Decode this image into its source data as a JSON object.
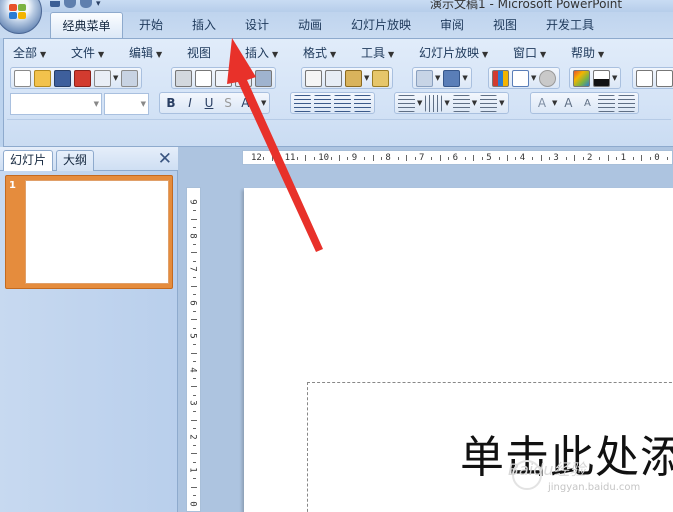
{
  "window": {
    "title": "演示文稿1 - Microsoft PowerPoint"
  },
  "ribbon_tabs": [
    "经典菜单",
    "开始",
    "插入",
    "设计",
    "动画",
    "幻灯片放映",
    "审阅",
    "视图",
    "开发工具"
  ],
  "active_tab": "经典菜单",
  "menubar": [
    "全部",
    "文件",
    "编辑",
    "视图",
    "插入",
    "格式",
    "工具",
    "幻灯片放映",
    "窗口",
    "帮助"
  ],
  "format_buttons": {
    "bold": "B",
    "italic": "I",
    "underline": "U",
    "strike": "S",
    "case": "Aa"
  },
  "panel_tabs": {
    "slides": "幻灯片",
    "outline": "大纲"
  },
  "thumbnail": {
    "number": "1"
  },
  "slide": {
    "title_placeholder": "单击此处添"
  },
  "ruler": {
    "horizontal": [
      "12",
      "11",
      "10",
      "9",
      "8",
      "7",
      "6",
      "5",
      "4",
      "3",
      "2",
      "1",
      "0"
    ],
    "vertical": [
      "9",
      "8",
      "7",
      "6",
      "5",
      "4",
      "3",
      "2",
      "1",
      "0"
    ]
  },
  "watermark": {
    "text": "Baidu经验",
    "url": "jingyan.baidu.com"
  },
  "colors": {
    "arrow": "#e8312a",
    "accent": "#e58c3d",
    "ribbon": "#d4e3f6"
  },
  "annotation": {
    "type": "red-arrow",
    "points_to": "插入"
  }
}
